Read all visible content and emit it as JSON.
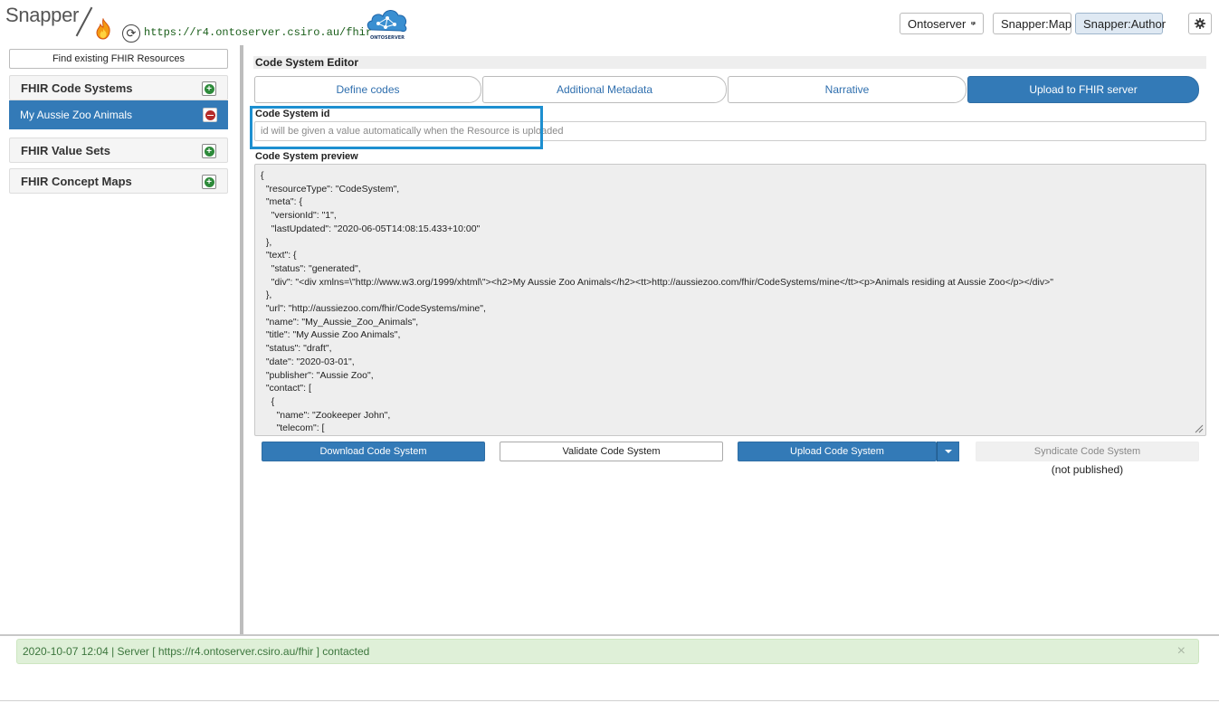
{
  "header": {
    "brand": "Snapper",
    "server_url": "https://r4.ontoserver.csiro.au/fhir",
    "logo_text": "ONTOSERVER",
    "nav": [
      {
        "label": "Ontoserver"
      },
      {
        "label": "Snapper:Map"
      },
      {
        "label": "Snapper:Author",
        "active": true
      }
    ],
    "icons": [
      "flame-icon",
      "refresh-icon",
      "ontoserver-cloud-logo",
      "monitor-icon",
      "gear-icon"
    ]
  },
  "sidebar": {
    "find_button": "Find existing FHIR Resources",
    "sections": [
      {
        "title": "FHIR Code Systems",
        "items": [
          "My Aussie Zoo Animals"
        ]
      },
      {
        "title": "FHIR Value Sets",
        "items": []
      },
      {
        "title": "FHIR Concept Maps",
        "items": []
      }
    ]
  },
  "editor": {
    "title": "Code System Editor",
    "tabs": [
      {
        "label": "Define codes"
      },
      {
        "label": "Additional Metadata"
      },
      {
        "label": "Narrative"
      },
      {
        "label": "Upload to FHIR server",
        "active": true
      }
    ],
    "id_label": "Code System id",
    "id_placeholder": "id will be given a value automatically when the Resource is uploaded",
    "preview_label": "Code System preview",
    "preview_lines": [
      "{",
      "  \"resourceType\": \"CodeSystem\",",
      "  \"meta\": {",
      "    \"versionId\": \"1\",",
      "    \"lastUpdated\": \"2020-06-05T14:08:15.433+10:00\"",
      "  },",
      "  \"text\": {",
      "    \"status\": \"generated\",",
      "    \"div\": \"<div xmlns=\\\"http://www.w3.org/1999/xhtml\\\"><h2>My Aussie Zoo Animals</h2><tt>http://aussiezoo.com/fhir/CodeSystems/mine</tt><p>Animals residing at Aussie Zoo</p></div>\"",
      "  },",
      "  \"url\": \"http://aussiezoo.com/fhir/CodeSystems/mine\",",
      "  \"name\": \"My_Aussie_Zoo_Animals\",",
      "  \"title\": \"My Aussie Zoo Animals\",",
      "  \"status\": \"draft\",",
      "  \"date\": \"2020-03-01\",",
      "  \"publisher\": \"Aussie Zoo\",",
      "  \"contact\": [",
      "    {",
      "      \"name\": \"Zookeeper John\",",
      "      \"telecom\": ["
    ],
    "actions": {
      "download": "Download Code System",
      "validate": "Validate Code System",
      "upload": "Upload Code System",
      "syndicate": "Syndicate Code System",
      "publish_status": "(not published)"
    }
  },
  "status": {
    "message": "2020-10-07 12:04 | Server [ https://r4.ontoserver.csiro.au/fhir ] contacted",
    "close": "×"
  },
  "colors": {
    "primary": "#337ab7",
    "highlight": "#1d8fd0",
    "success_bg": "#dff0d8",
    "success_text": "#3c763d",
    "danger": "#b52b2b",
    "add_green": "#2d8a3a"
  }
}
